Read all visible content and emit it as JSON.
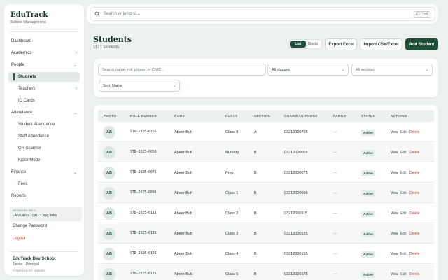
{
  "brand": {
    "title": "EduTrack",
    "subtitle": "School Management"
  },
  "sidebar": {
    "items": [
      {
        "label": "Dashboard"
      },
      {
        "label": "Academics",
        "icon": "chevron-right-icon"
      },
      {
        "label": "People",
        "icon": "chevron-down-icon"
      },
      {
        "label": "Students"
      },
      {
        "label": "Teachers",
        "icon": "chevron-right-icon"
      },
      {
        "label": "ID Cards"
      },
      {
        "label": "Attendance",
        "icon": "chevron-down-icon"
      },
      {
        "label": "Student Attendance"
      },
      {
        "label": "Staff Attendance"
      },
      {
        "label": "QR Scanner"
      },
      {
        "label": "Kiosk Mode"
      },
      {
        "label": "Finance",
        "icon": "chevron-down-icon"
      },
      {
        "label": "Fees"
      },
      {
        "label": "Reports"
      }
    ],
    "network": {
      "title": "NETWORK INFO",
      "text": "LAN URLs · QR · Copy links"
    },
    "change_password": "Change Password",
    "logout": "Logout",
    "school": {
      "name": "EduTrack Dev School",
      "user": "Jawad · Principal",
      "powered": "POWERED BY ONAIRO"
    }
  },
  "search": {
    "placeholder": "Search or jump to...",
    "shortcut": "Ctrl+K"
  },
  "header": {
    "title": "Students",
    "count": "1121 students"
  },
  "view_toggle": {
    "list": "List",
    "blocks": "Blocks"
  },
  "actions": {
    "export": "Export Excel",
    "import": "Import CSV/Excel",
    "add": "Add Student"
  },
  "filters": {
    "search_placeholder": "Search name, roll, phone, or CNIC...",
    "class": "All classes",
    "section": "All sections",
    "sort": "Sort: Name"
  },
  "table": {
    "headers": [
      "PHOTO",
      "ROLL NUMBER",
      "NAME",
      "CLASS",
      "SECTION",
      "GUARDIAN PHONE",
      "FAMILY",
      "STATUS",
      "ACTIONS"
    ],
    "row_actions": {
      "view": "View",
      "edit": "Edit",
      "delete": "Delete"
    },
    "rows": [
      {
        "initials": "AB",
        "roll": "STD-2025-0756",
        "name": "Abeer Butt",
        "class": "Class 8",
        "section": "A",
        "phone": "03212000755",
        "family": "—",
        "status": "Active"
      },
      {
        "initials": "AB",
        "roll": "STD-2025-0056",
        "name": "Abeer Butt",
        "class": "Nursery",
        "section": "B",
        "phone": "03212000055",
        "family": "—",
        "status": "Active"
      },
      {
        "initials": "AB",
        "roll": "STD-2025-0076",
        "name": "Abeer Butt",
        "class": "Prep",
        "section": "B",
        "phone": "03212000075",
        "family": "—",
        "status": "Active"
      },
      {
        "initials": "AB",
        "roll": "STD-2025-0096",
        "name": "Abeer Butt",
        "class": "Class 1",
        "section": "B",
        "phone": "03212000095",
        "family": "—",
        "status": "Active"
      },
      {
        "initials": "AB",
        "roll": "STD-2025-0116",
        "name": "Abeer Butt",
        "class": "Class 2",
        "section": "B",
        "phone": "03212000115",
        "family": "—",
        "status": "Active"
      },
      {
        "initials": "AB",
        "roll": "STD-2025-0136",
        "name": "Abeer Butt",
        "class": "Class 3",
        "section": "B",
        "phone": "03212000135",
        "family": "—",
        "status": "Active"
      },
      {
        "initials": "AB",
        "roll": "STD-2025-0156",
        "name": "Abeer Butt",
        "class": "Class 4",
        "section": "B",
        "phone": "03212000155",
        "family": "—",
        "status": "Active"
      },
      {
        "initials": "AB",
        "roll": "STD-2025-0176",
        "name": "Abeer Butt",
        "class": "Class 5",
        "section": "B",
        "phone": "03212000175",
        "family": "—",
        "status": "Active"
      }
    ]
  },
  "colors": {
    "brand_dark": "#1f4d3a",
    "danger": "#c0392b",
    "status_bg": "#e3eee7"
  }
}
